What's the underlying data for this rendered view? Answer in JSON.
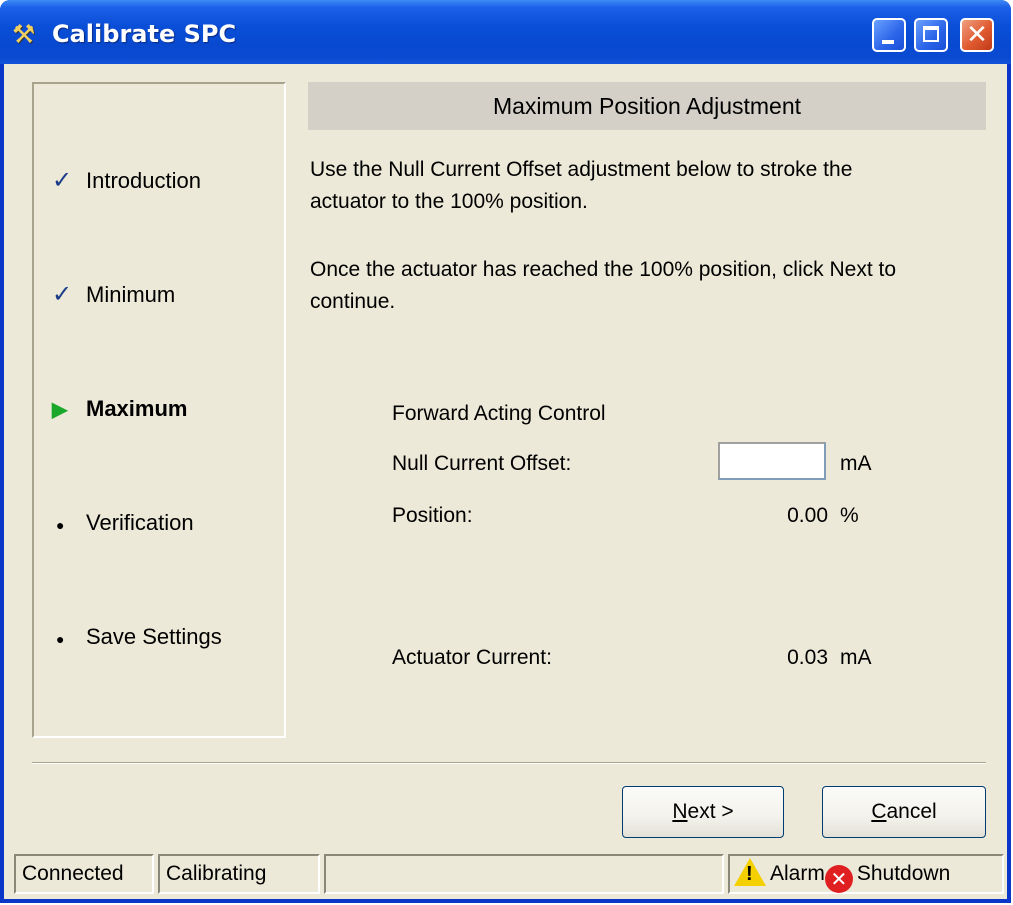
{
  "window": {
    "title": "Calibrate SPC",
    "icon": "tools-icon",
    "controls": [
      "minimize",
      "maximize",
      "close"
    ]
  },
  "steps": [
    {
      "label": "Introduction",
      "state": "done",
      "icon": "checkmark-icon"
    },
    {
      "label": "Minimum",
      "state": "done",
      "icon": "checkmark-icon"
    },
    {
      "label": "Maximum",
      "state": "current",
      "icon": "play-arrow-icon"
    },
    {
      "label": "Verification",
      "state": "pending",
      "icon": "bullet-icon"
    },
    {
      "label": "Save Settings",
      "state": "pending",
      "icon": "bullet-icon"
    }
  ],
  "panel": {
    "header": "Maximum Position Adjustment",
    "paragraph1_line1": "Use the Null Current Offset adjustment below to stroke the",
    "paragraph1_line2": "actuator to the 100% position.",
    "paragraph2_line1": "Once the actuator has reached the 100% position, click Next to",
    "paragraph2_line2": "continue.",
    "section_label": "Forward Acting Control",
    "null_offset_label": "Null Current Offset:",
    "null_offset_value": "",
    "null_offset_unit": "mA",
    "position_label": "Position:",
    "position_value": "0.00",
    "position_unit": "%",
    "actuator_label": "Actuator Current:",
    "actuator_value": "0.03",
    "actuator_unit": "mA"
  },
  "buttons": {
    "next_mnemonic": "N",
    "next_rest": "ext >",
    "cancel_mnemonic": "C",
    "cancel_rest": "ancel"
  },
  "status": {
    "connection": "Connected",
    "mode": "Calibrating",
    "message": "",
    "alarm": "Alarm",
    "shutdown": "Shutdown"
  },
  "colors": {
    "titlebar": "#0a4fd8",
    "dialog_bg": "#ece9d8",
    "header_bg": "#d4d0c8",
    "current_step_arrow": "#1aa82a",
    "alarm_icon": "#f5d000",
    "shutdown_icon": "#e02020"
  }
}
